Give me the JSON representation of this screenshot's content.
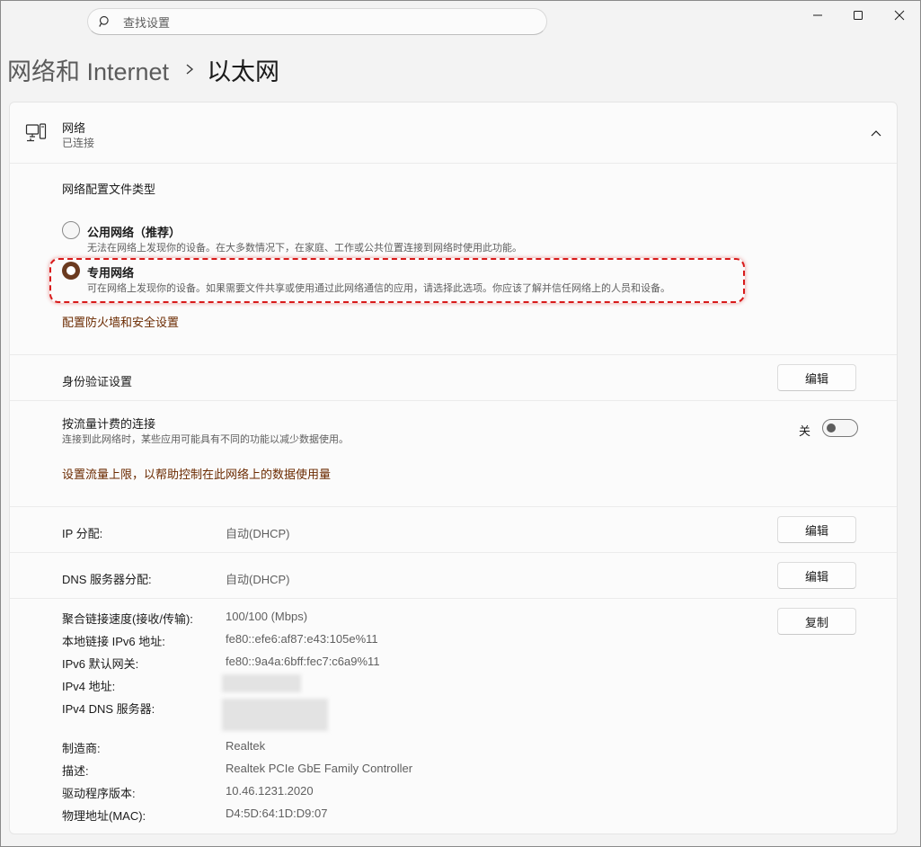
{
  "search": {
    "placeholder": "查找设置"
  },
  "breadcrumb": {
    "parent": "网络和 Internet",
    "current": "以太网"
  },
  "network": {
    "title": "网络",
    "status": "已连接"
  },
  "profile": {
    "heading": "网络配置文件类型",
    "options": [
      {
        "label": "公用网络（推荐）",
        "desc": "无法在网络上发现你的设备。在大多数情况下，在家庭、工作或公共位置连接到网络时使用此功能。",
        "selected": false
      },
      {
        "label": "专用网络",
        "desc": "可在网络上发现你的设备。如果需要文件共享或使用通过此网络通信的应用，请选择此选项。你应该了解并信任网络上的人员和设备。",
        "selected": true
      }
    ],
    "firewall_link": "配置防火墙和安全设置"
  },
  "auth": {
    "label": "身份验证设置",
    "button": "编辑"
  },
  "metered": {
    "label": "按流量计费的连接",
    "desc": "连接到此网络时，某些应用可能具有不同的功能以减少数据使用。",
    "toggle_label": "关",
    "toggle_on": false,
    "link": "设置流量上限，以帮助控制在此网络上的数据使用量"
  },
  "ip": {
    "label": "IP 分配:",
    "value": "自动(DHCP)",
    "button": "编辑"
  },
  "dns": {
    "label": "DNS 服务器分配:",
    "value": "自动(DHCP)",
    "button": "编辑"
  },
  "props": {
    "copy_button": "复制",
    "items": [
      {
        "label": "聚合链接速度(接收/传输):",
        "value": "100/100 (Mbps)"
      },
      {
        "label": "本地链接 IPv6 地址:",
        "value": "fe80::efe6:af87:e43:105e%11"
      },
      {
        "label": "IPv6 默认网关:",
        "value": "fe80::9a4a:6bff:fec7:c6a9%11"
      },
      {
        "label": "IPv4 地址:",
        "value": ""
      },
      {
        "label": "IPv4 DNS 服务器:",
        "value": ""
      },
      {
        "label": "制造商:",
        "value": "Realtek"
      },
      {
        "label": "描述:",
        "value": "Realtek PCIe GbE Family Controller"
      },
      {
        "label": "驱动程序版本:",
        "value": "10.46.1231.2020"
      },
      {
        "label": "物理地址(MAC):",
        "value": "D4:5D:64:1D:D9:07"
      }
    ]
  },
  "colors": {
    "accent": "#6b3a1f",
    "link": "#6b2a00",
    "highlight": "#d81a1a"
  }
}
